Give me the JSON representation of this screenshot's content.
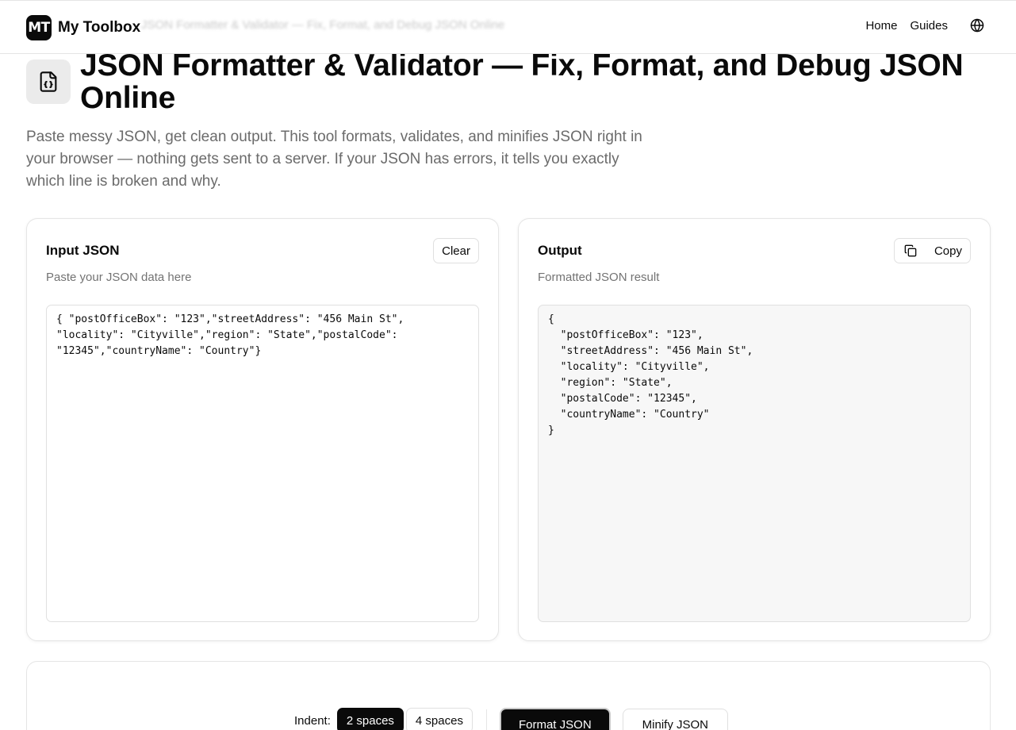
{
  "nav": {
    "logo_text": "MT",
    "brand": "My Toolbox",
    "ghost_title": "JSON Formatter & Validator — Fix, Format, and Debug JSON Online",
    "links": [
      "Home",
      "Guides"
    ],
    "language_icon": "globe-icon"
  },
  "hero": {
    "icon": "file-json-icon",
    "title": "JSON Formatter & Validator — Fix, Format, and Debug JSON Online",
    "description": "Paste messy JSON, get clean output. This tool formats, validates, and minifies JSON right in your browser — nothing gets sent to a server. If your JSON has errors, it tells you exactly which line is broken and why."
  },
  "input_panel": {
    "title": "Input JSON",
    "subtitle": "Paste your JSON data here",
    "clear_label": "Clear",
    "value": "{ \"postOfficeBox\": \"123\",\"streetAddress\": \"456 Main St\",\n\"locality\": \"Cityville\",\"region\": \"State\",\"postalCode\":\n\"12345\",\"countryName\": \"Country\"}"
  },
  "output_panel": {
    "title": "Output",
    "subtitle": "Formatted JSON result",
    "copy_label": "Copy",
    "copy_icon": "copy-icon",
    "value": "{\n  \"postOfficeBox\": \"123\",\n  \"streetAddress\": \"456 Main St\",\n  \"locality\": \"Cityville\",\n  \"region\": \"State\",\n  \"postalCode\": \"12345\",\n  \"countryName\": \"Country\"\n}"
  },
  "controls": {
    "indent_label": "Indent:",
    "indent_options": [
      "2 spaces",
      "4 spaces"
    ],
    "indent_selected": "2 spaces",
    "format_label": "Format JSON",
    "minify_label": "Minify JSON"
  },
  "colors": {
    "accent": "#0a0a0a",
    "muted_text": "#6b6b6b",
    "border": "#e5e5e5",
    "output_bg": "#f7f7f7"
  }
}
